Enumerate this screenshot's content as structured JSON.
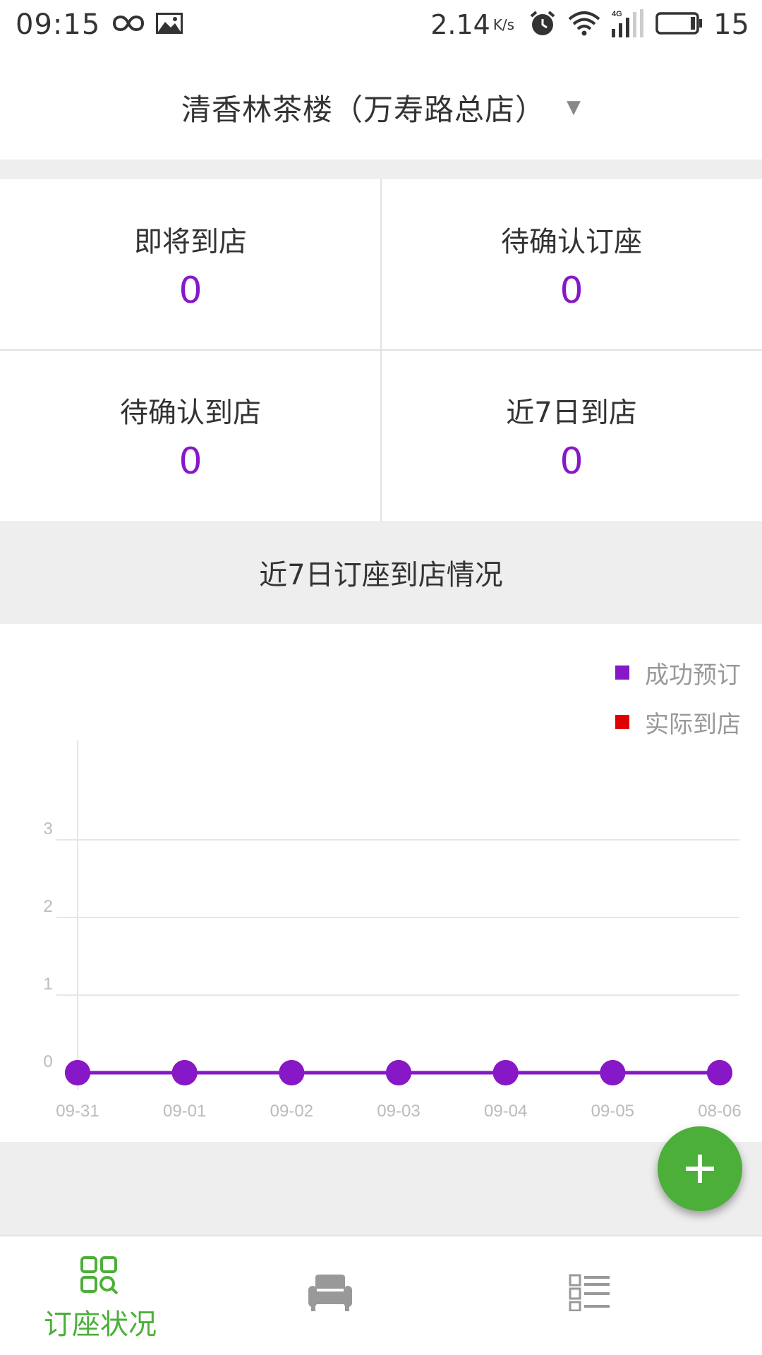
{
  "status_bar": {
    "time": "09:15",
    "speed": "2.14",
    "speed_unit": "K/s",
    "network": "4G",
    "battery": "15",
    "icons": [
      "infinity-icon",
      "image-icon",
      "alarm-icon",
      "wifi-icon",
      "signal-icon",
      "battery-icon"
    ]
  },
  "header": {
    "store_name": "清香林茶楼（万寿路总店）",
    "caret": "▼"
  },
  "stats": [
    {
      "label": "即将到店",
      "value": "0"
    },
    {
      "label": "待确认订座",
      "value": "0"
    },
    {
      "label": "待确认到店",
      "value": "0"
    },
    {
      "label": "近7日到店",
      "value": "0"
    }
  ],
  "section": {
    "title": "近7日订座到店情况"
  },
  "chart_data": {
    "type": "line",
    "title": "",
    "xlabel": "",
    "ylabel": "",
    "x": [
      "09-31",
      "09-01",
      "09-02",
      "09-03",
      "09-04",
      "09-05",
      "08-06"
    ],
    "y_ticks": [
      "0",
      "1",
      "2",
      "3"
    ],
    "ylim": [
      0,
      3
    ],
    "grid": true,
    "legend_position": "top-right",
    "series": [
      {
        "name": "成功预订",
        "color": "#8718c8",
        "values": [
          0,
          0,
          0,
          0,
          0,
          0,
          0
        ]
      },
      {
        "name": "实际到店",
        "color": "#e00000",
        "values": [
          0,
          0,
          0,
          0,
          0,
          0,
          0
        ]
      }
    ]
  },
  "fab": {
    "icon": "plus-icon"
  },
  "bottom_nav": {
    "items": [
      {
        "label": "订座状况",
        "icon": "grid-search-icon",
        "active": true
      },
      {
        "label": "",
        "icon": "sofa-icon",
        "active": false
      },
      {
        "label": "",
        "icon": "list-icon",
        "active": false
      }
    ]
  },
  "colors": {
    "accent_purple": "#8718c8",
    "accent_green": "#4caf3a",
    "legend_red": "#e00000"
  }
}
